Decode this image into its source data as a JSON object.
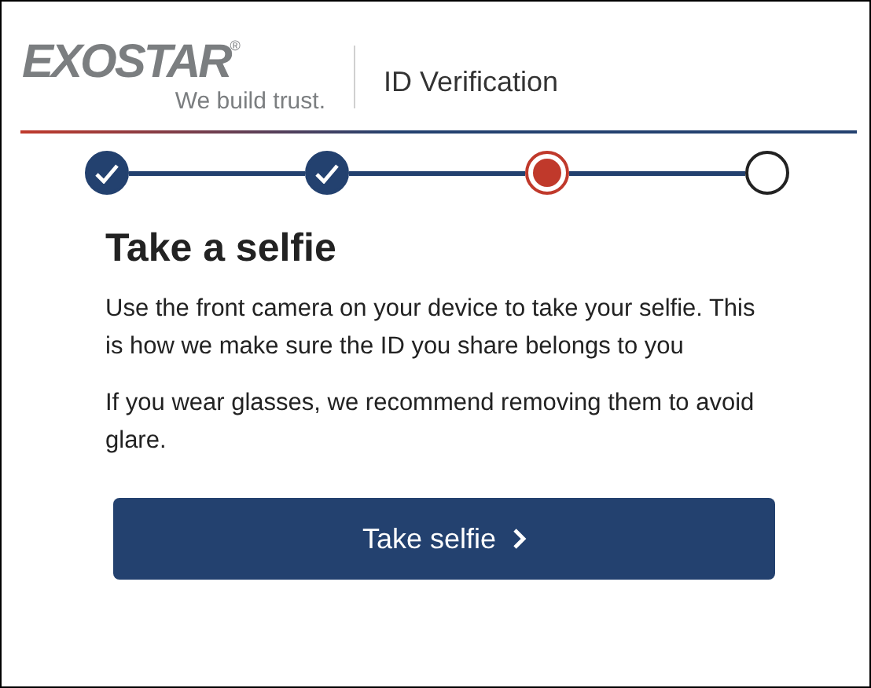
{
  "header": {
    "logo": "EXOSTAR$^{®}$",
    "tagline": "We build trust.",
    "title": "ID Verification"
  },
  "steps": [
    {
      "kind": "done"
    },
    {
      "kind": "done"
    },
    {
      "kind": "current"
    },
    {
      "kind": "pending"
    }
  ],
  "heading": "Take a selfie",
  "paragraphs": [
    "Use the front camera on your device to take your selfie. This is how we make sure the ID you share belongs to you",
    "If you wear glasses, we recommend removing them to avoid glare."
  ],
  "button": {
    "label": "Take selfie"
  }
}
